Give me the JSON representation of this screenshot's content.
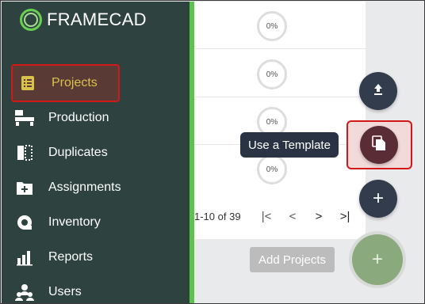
{
  "app": {
    "brand": "FRAMECAD"
  },
  "sidebar": {
    "items": [
      {
        "label": "Projects",
        "icon": "list-icon",
        "active": true
      },
      {
        "label": "Production",
        "icon": "production-icon"
      },
      {
        "label": "Duplicates",
        "icon": "duplicates-icon"
      },
      {
        "label": "Assignments",
        "icon": "assignments-icon"
      },
      {
        "label": "Inventory",
        "icon": "inventory-icon"
      },
      {
        "label": "Reports",
        "icon": "reports-icon"
      },
      {
        "label": "Users",
        "icon": "users-icon"
      }
    ]
  },
  "list": {
    "rows": [
      {
        "progress": "0%"
      },
      {
        "progress": "0%"
      },
      {
        "progress": "0%"
      },
      {
        "progress": "0%"
      }
    ]
  },
  "pager": {
    "range": "1-10 of 39",
    "first": "|<",
    "prev": "<",
    "next": ">",
    "last": ">|"
  },
  "fabs": {
    "tooltip": "Use a Template",
    "add_projects": "Add Projects",
    "plus": "+"
  },
  "colors": {
    "sidebar": "#2e4240",
    "accent_green": "#5cc34a",
    "fab": "#333c4c",
    "highlight": "#d21818"
  }
}
